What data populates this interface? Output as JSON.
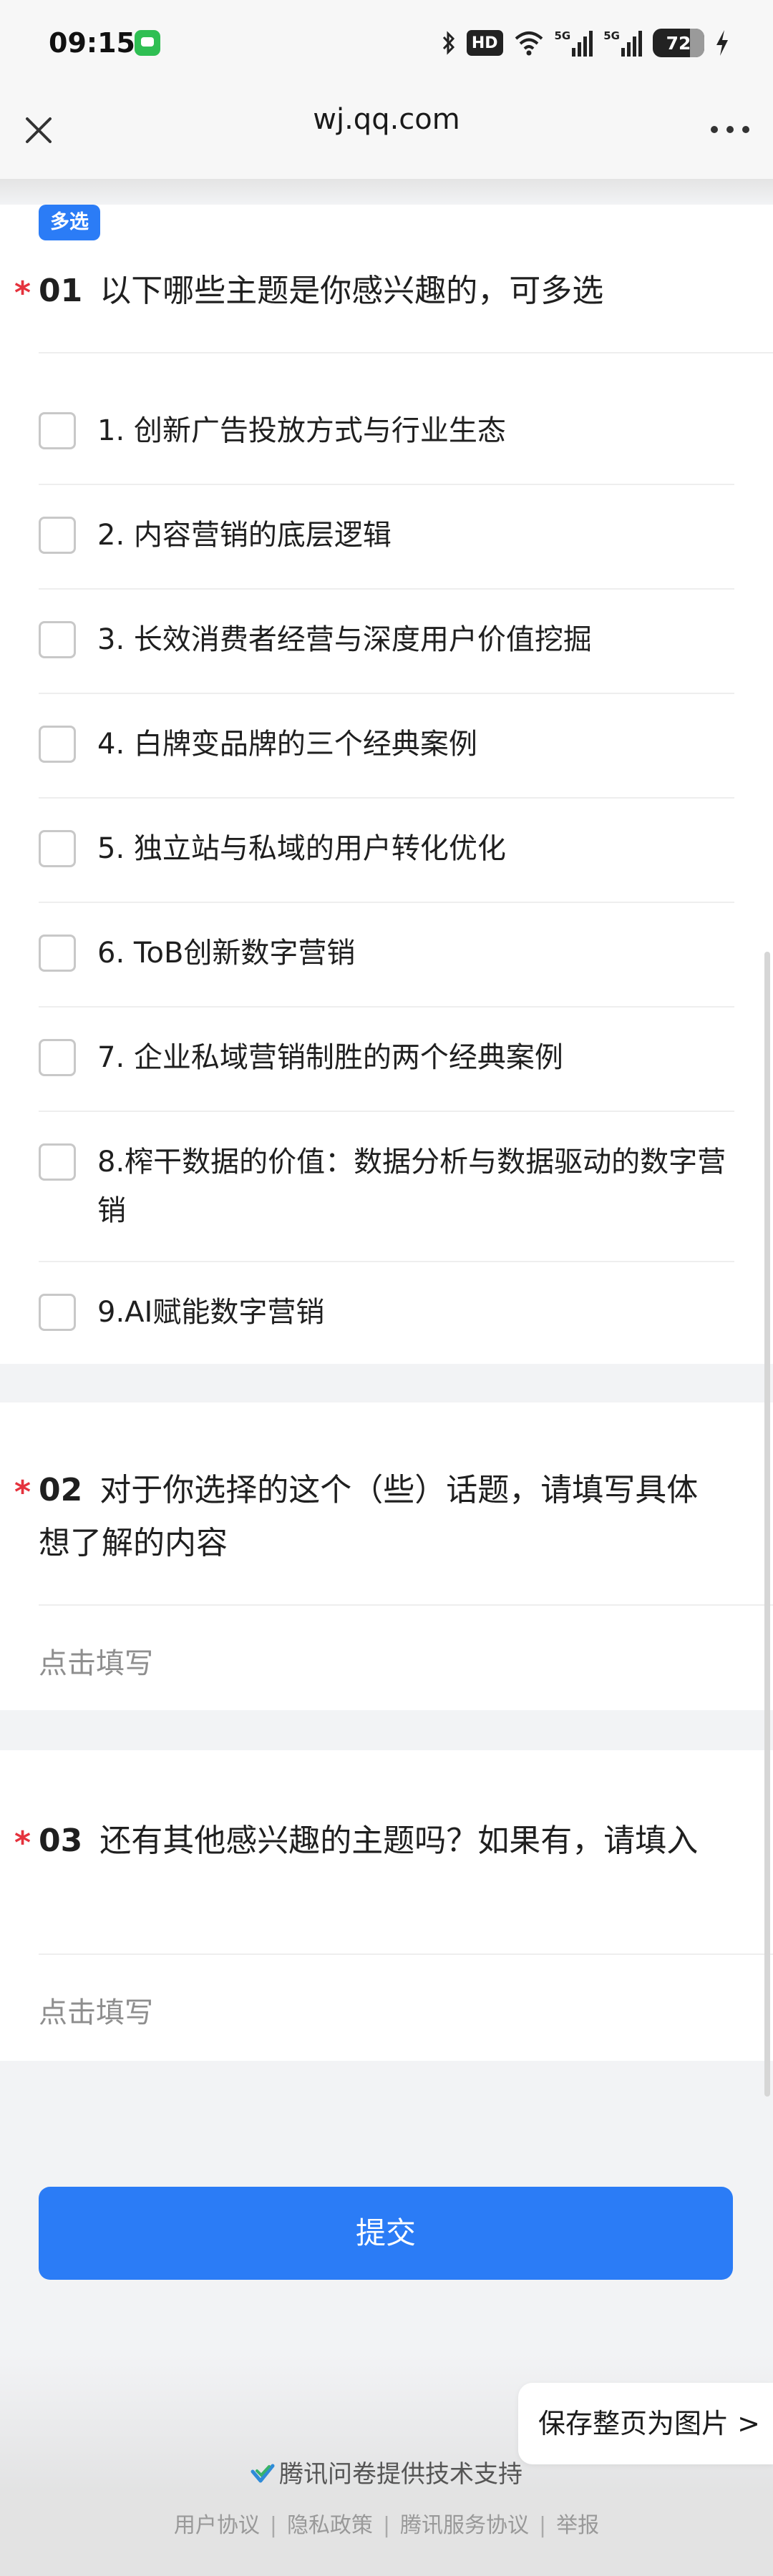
{
  "status_bar": {
    "time": "09:15",
    "hd_label": "HD",
    "signal_1_label": "5G",
    "signal_2_label": "5G",
    "battery_level": "72",
    "battery_fraction": 0.72
  },
  "nav": {
    "title": "wj.qq.com",
    "close_icon": "close-icon",
    "more_icon": "more-icon"
  },
  "question_1": {
    "tag": "多选",
    "required_mark": "*",
    "number": "01",
    "title": "以下哪些主题是你感兴趣的，可多选",
    "options": [
      "1. 创新广告投放方式与行业生态",
      "2. 内容营销的底层逻辑",
      "3. 长效消费者经营与深度用户价值挖掘",
      "4. 白牌变品牌的三个经典案例",
      "5. 独立站与私域的用户转化优化",
      "6. ToB创新数字营销",
      "7. 企业私域营销制胜的两个经典案例",
      "8.榨干数据的价值：数据分析与数据驱动的数字营销",
      "9.AI赋能数字营销"
    ]
  },
  "question_2": {
    "required_mark": "*",
    "number": "02",
    "title": "对于你选择的这个（些）话题，请填写具体想了解的内容",
    "placeholder": "点击填写"
  },
  "question_3": {
    "required_mark": "*",
    "number": "03",
    "title": "还有其他感兴趣的主题吗？如果有，请填入",
    "placeholder": "点击填写"
  },
  "submit_label": "提交",
  "save_image_label": "保存整页为图片 >",
  "powered_by": "腾讯问卷提供技术支持",
  "footer_links": [
    "用户协议",
    "隐私政策",
    "腾讯服务协议",
    "举报"
  ],
  "colors": {
    "accent": "#2b7cf6",
    "required": "#e5323d",
    "page_bg": "#f2f3f5"
  }
}
